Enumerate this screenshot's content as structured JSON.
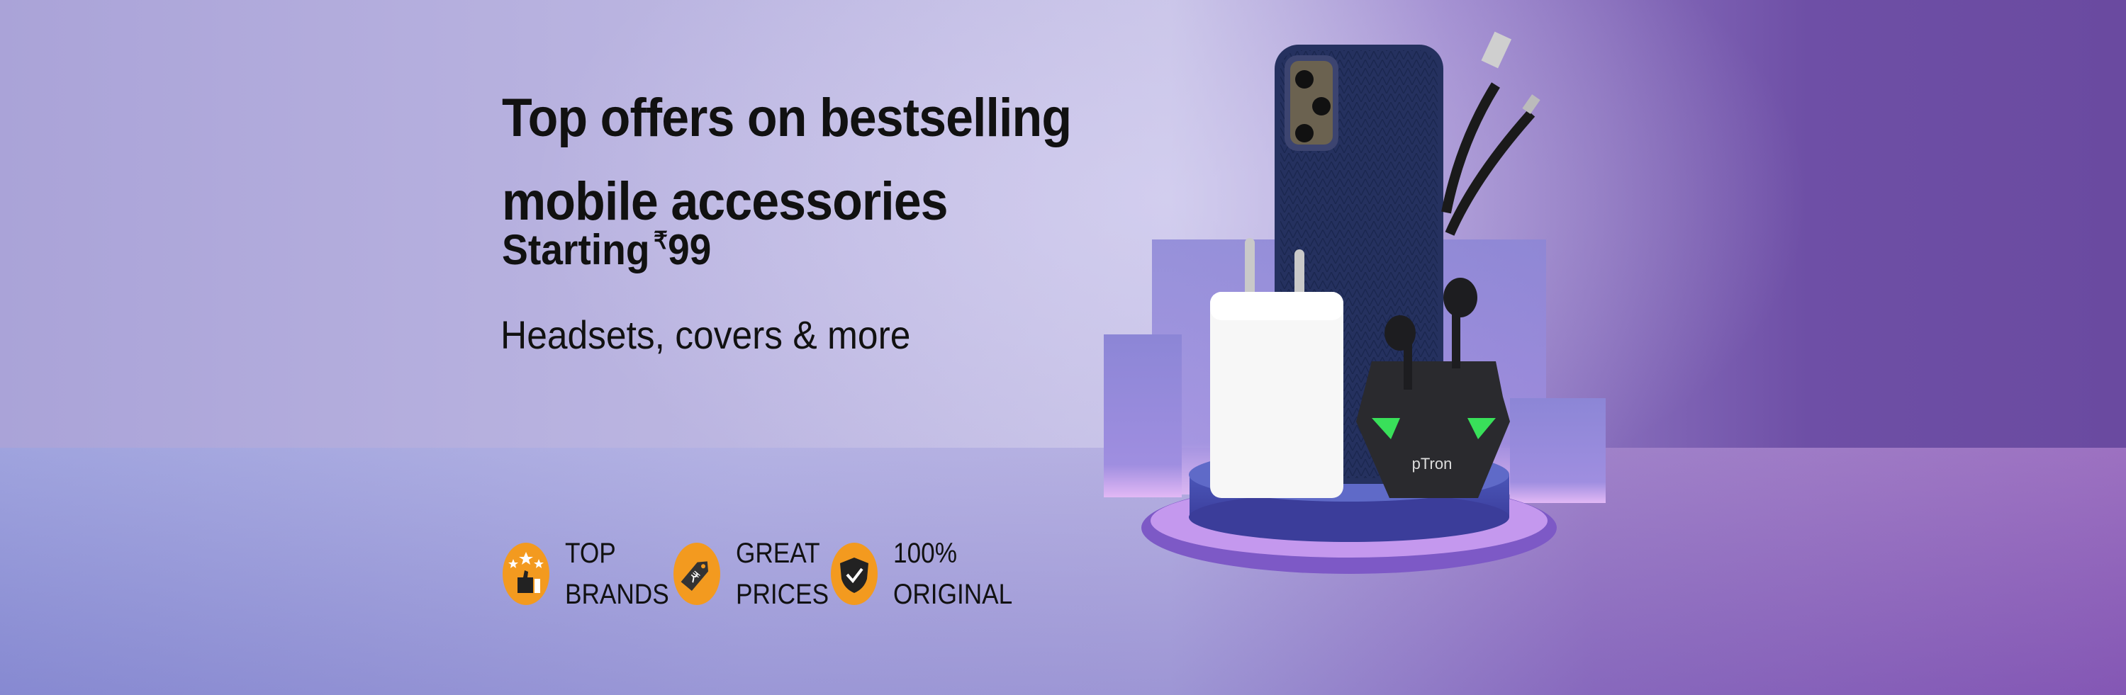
{
  "banner": {
    "title_line1": "Top offers on bestselling",
    "title_line2": "mobile accessories",
    "starting_label": "Starting",
    "currency_symbol": "₹",
    "starting_price": "99",
    "subtitle": "Headsets, covers & more",
    "badges": [
      {
        "icon": "thumbs-up-stars-icon",
        "line1": "TOP",
        "line2": "BRANDS"
      },
      {
        "icon": "rupee-tag-icon",
        "line1": "GREAT",
        "line2": "PRICES"
      },
      {
        "icon": "shield-check-icon",
        "line1": "100%",
        "line2": "ORIGINAL"
      }
    ],
    "product_brand": "pTron",
    "colors": {
      "badge_orange": "#f39a1f",
      "text": "#111111",
      "accent_green": "#39e05a"
    }
  }
}
